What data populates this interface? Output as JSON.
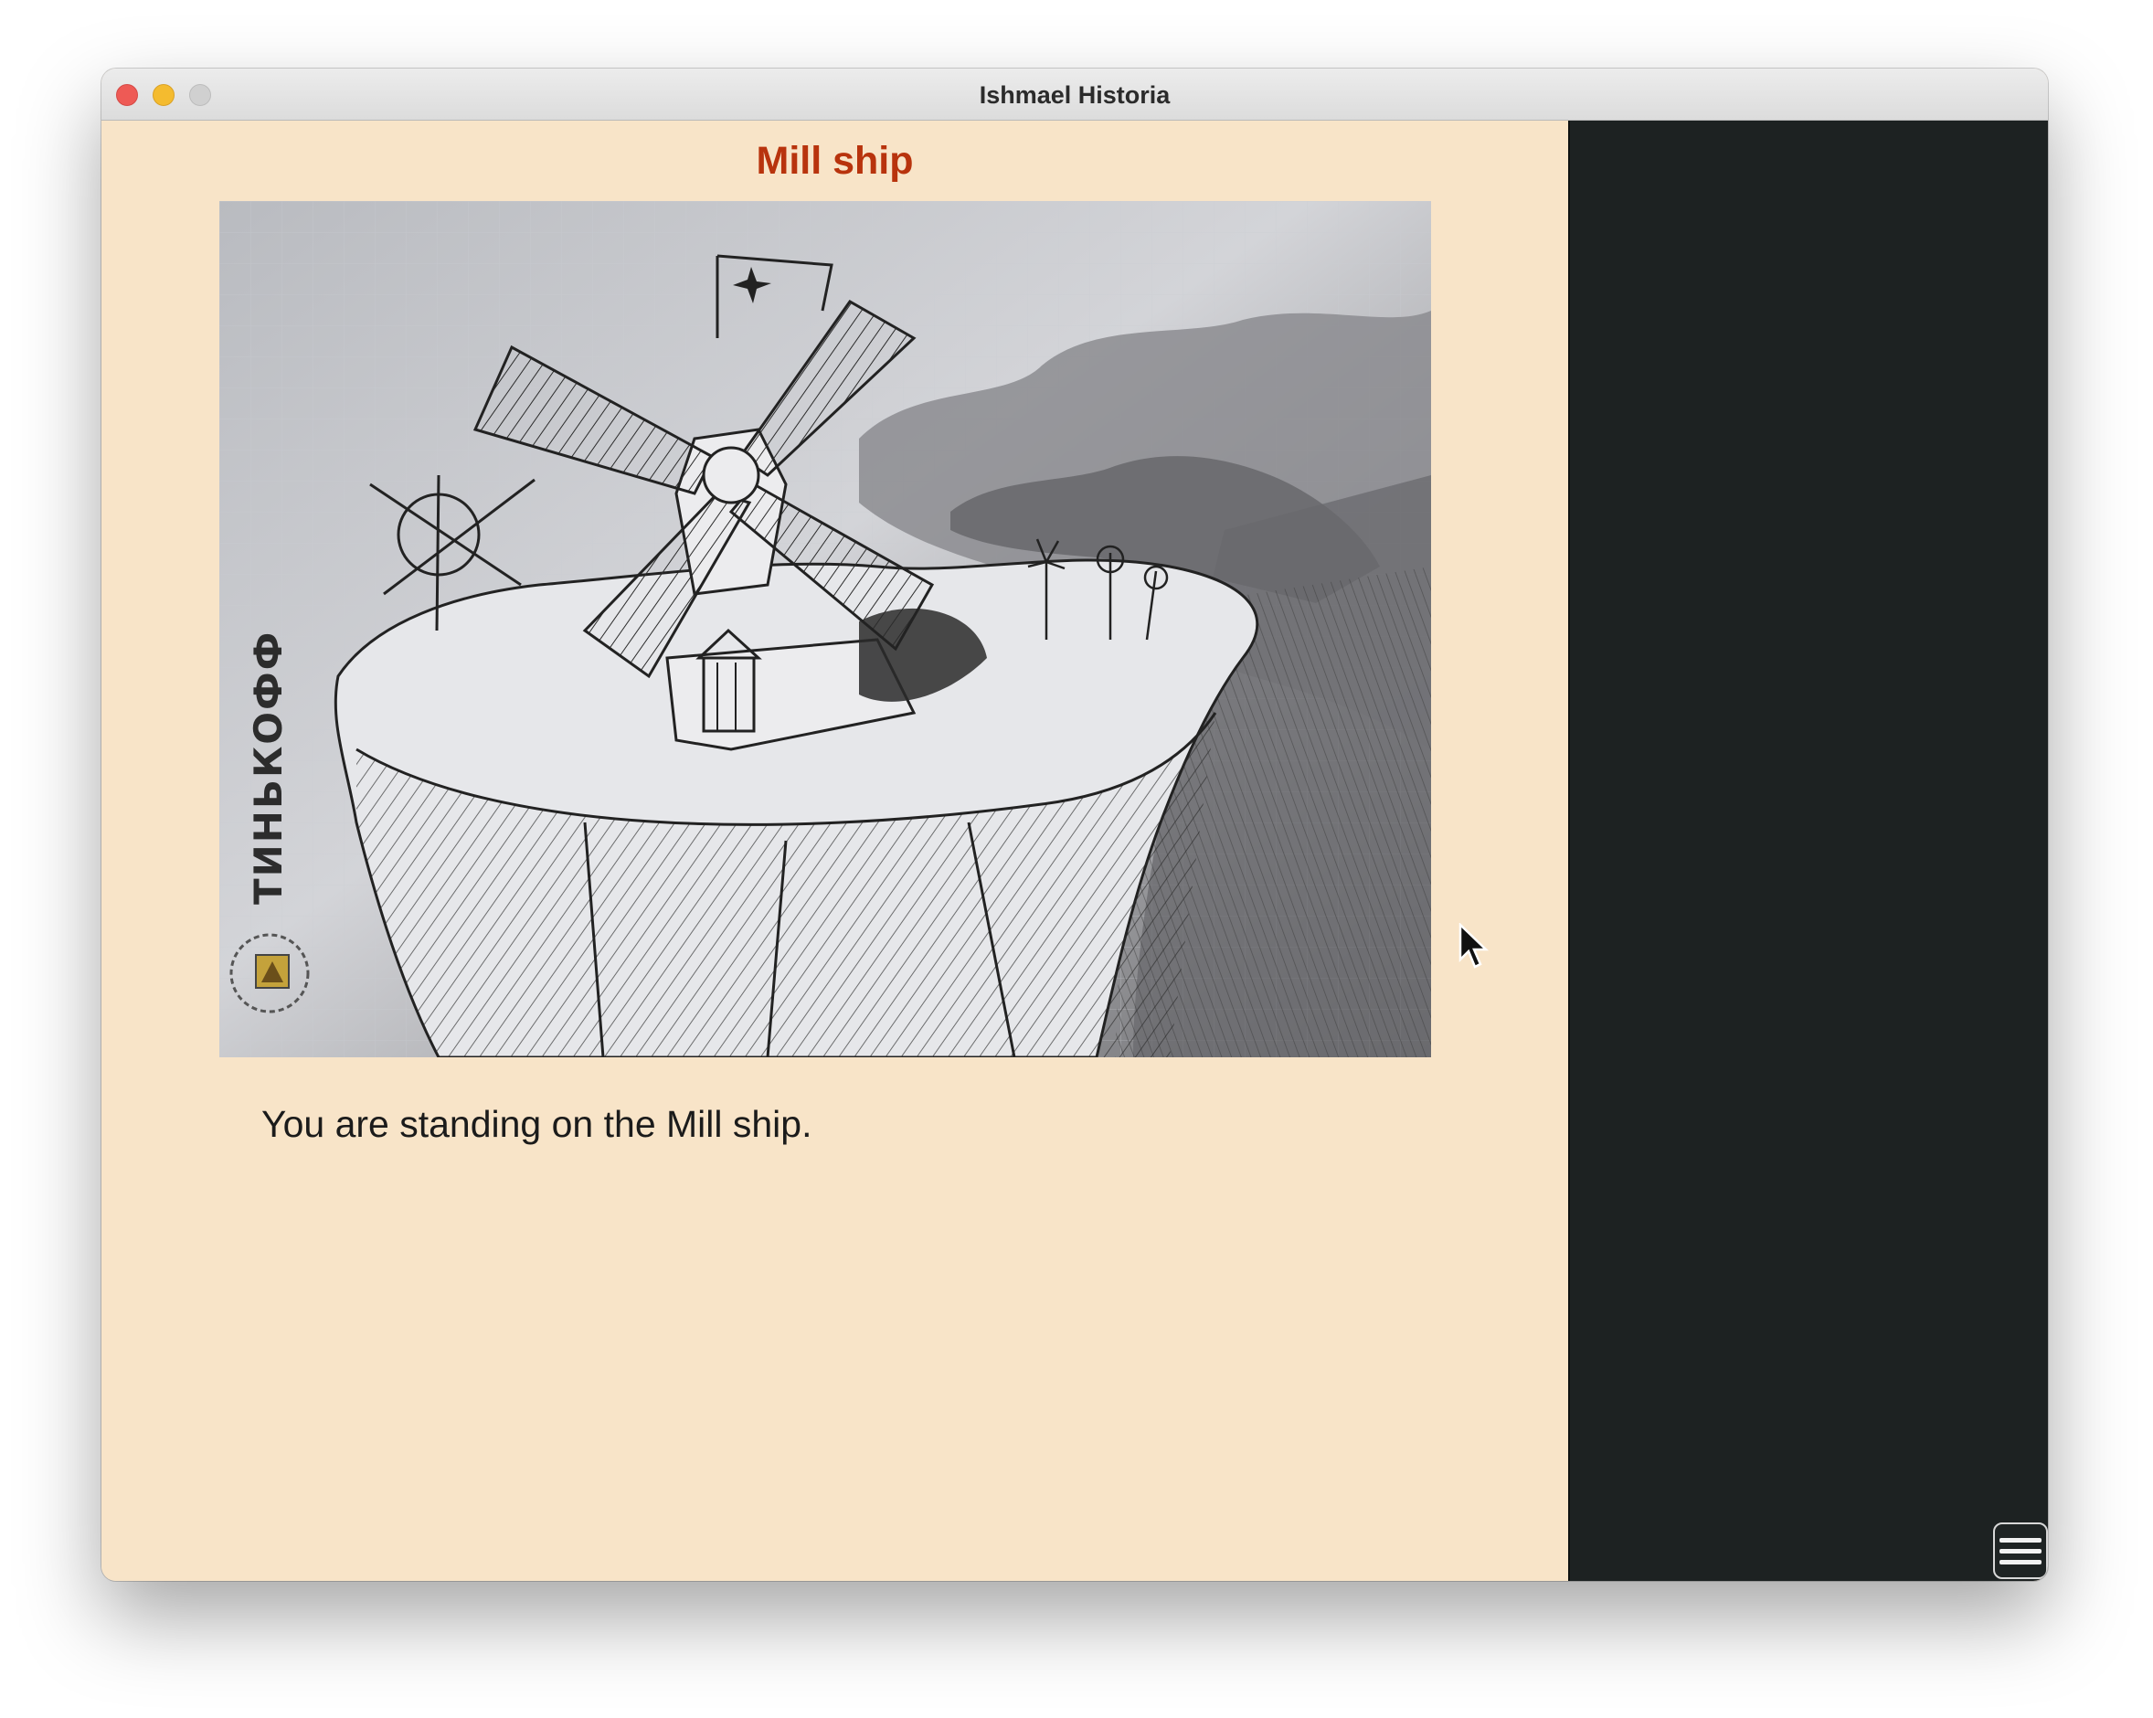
{
  "window": {
    "title": "Ishmael Historia",
    "controls": [
      "close",
      "minimize",
      "zoom"
    ]
  },
  "room": {
    "title": "Mill ship",
    "description": "You are standing on the Mill ship.",
    "image_icon": "windmill-on-floating-rock-sketch",
    "image_watermark": "ТИНЬКОФФ"
  },
  "sidebar": {
    "menu_icon": "hamburger-menu-icon"
  },
  "colors": {
    "content_background": "#f8e4c8",
    "title_color": "#b8330d",
    "sidebar_background": "#1d2222"
  }
}
